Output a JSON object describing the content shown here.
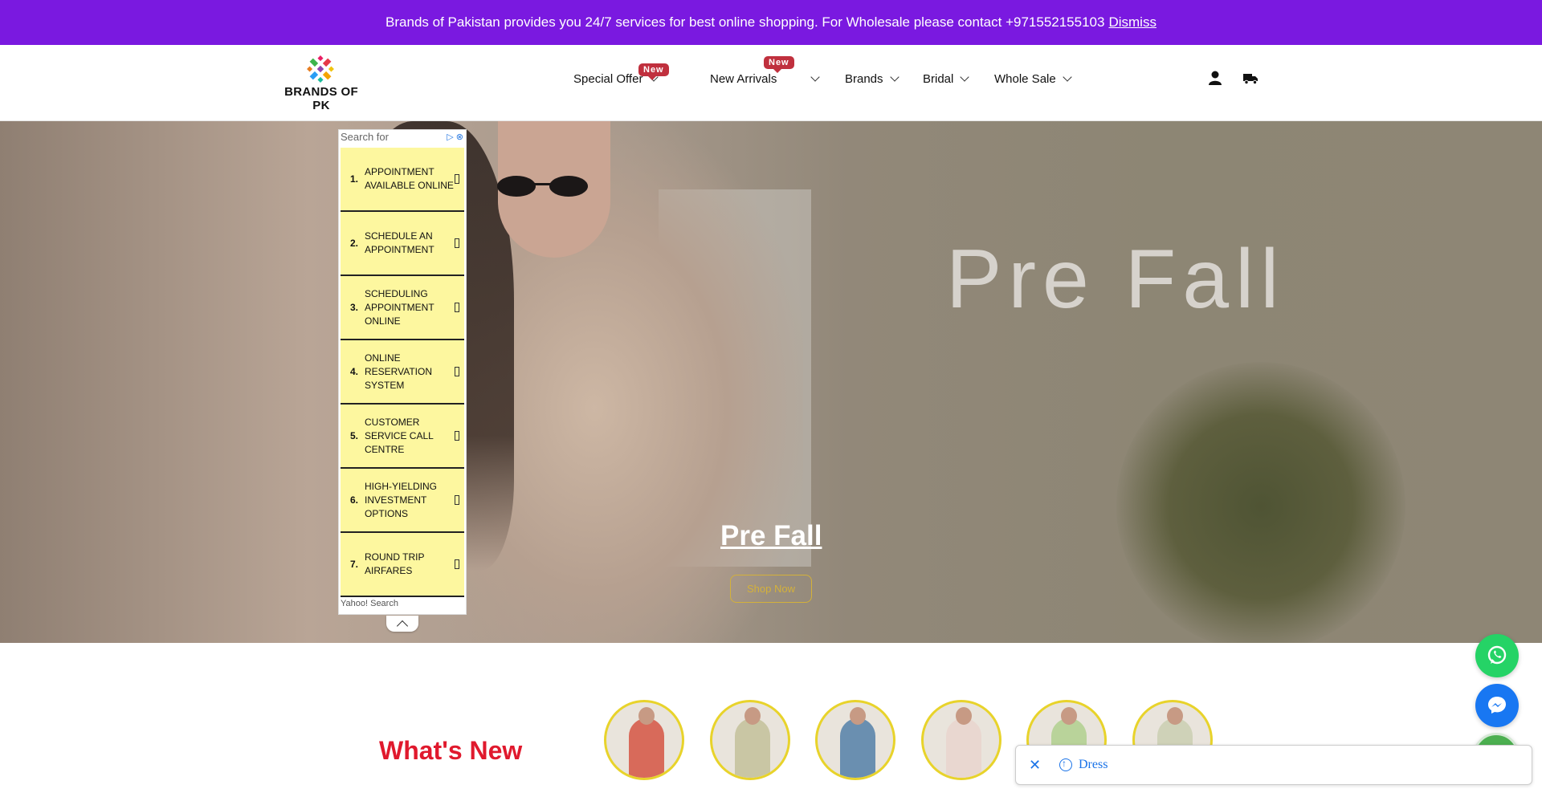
{
  "announcement": {
    "text": "Brands of Pakistan provides you 24/7 services for best online shopping. For Wholesale please contact +971552155103",
    "dismiss_label": "Dismiss"
  },
  "header": {
    "logo_text": "BRANDS OF PK",
    "nav": [
      {
        "label": "Special Offer",
        "badge": "New"
      },
      {
        "label": "New Arrivals",
        "badge": "New"
      },
      {
        "label": "Brands"
      },
      {
        "label": "Bridal"
      },
      {
        "label": "Whole Sale"
      }
    ],
    "icons": [
      "user-icon",
      "truck-icon"
    ]
  },
  "hero": {
    "watermark": "Pre Fall",
    "title": "Pre Fall",
    "button_label": "Shop Now"
  },
  "ad": {
    "search_placeholder": "Search for",
    "items": [
      {
        "num": "1.",
        "text": "APPOINTMENT AVAILABLE ONLINE"
      },
      {
        "num": "2.",
        "text": "SCHEDULE AN APPOINTMENT"
      },
      {
        "num": "3.",
        "text": "SCHEDULING APPOINTMENT ONLINE"
      },
      {
        "num": "4.",
        "text": "ONLINE RESERVATION SYSTEM"
      },
      {
        "num": "5.",
        "text": "CUSTOMER SERVICE CALL CENTRE"
      },
      {
        "num": "6.",
        "text": "HIGH-YIELDING INVESTMENT OPTIONS"
      },
      {
        "num": "7.",
        "text": "ROUND TRIP AIRFARES"
      }
    ],
    "footer": "Yahoo! Search"
  },
  "whats_new": {
    "title": "What's New",
    "circle_colors": [
      "#d86a5a",
      "#c9c6a4",
      "#6a8fb0",
      "#e9d7d0",
      "#b9d39a",
      "#cfd2b8"
    ]
  },
  "search_bar": {
    "query": "Dress"
  },
  "colors": {
    "announcement_bg": "#7a19e0",
    "badge": "#c0303e",
    "accent_gold": "#d4b13a",
    "title_red": "#e0192d",
    "whatsapp": "#25d366",
    "messenger": "#1877f2",
    "close_fab": "#4caf50"
  }
}
